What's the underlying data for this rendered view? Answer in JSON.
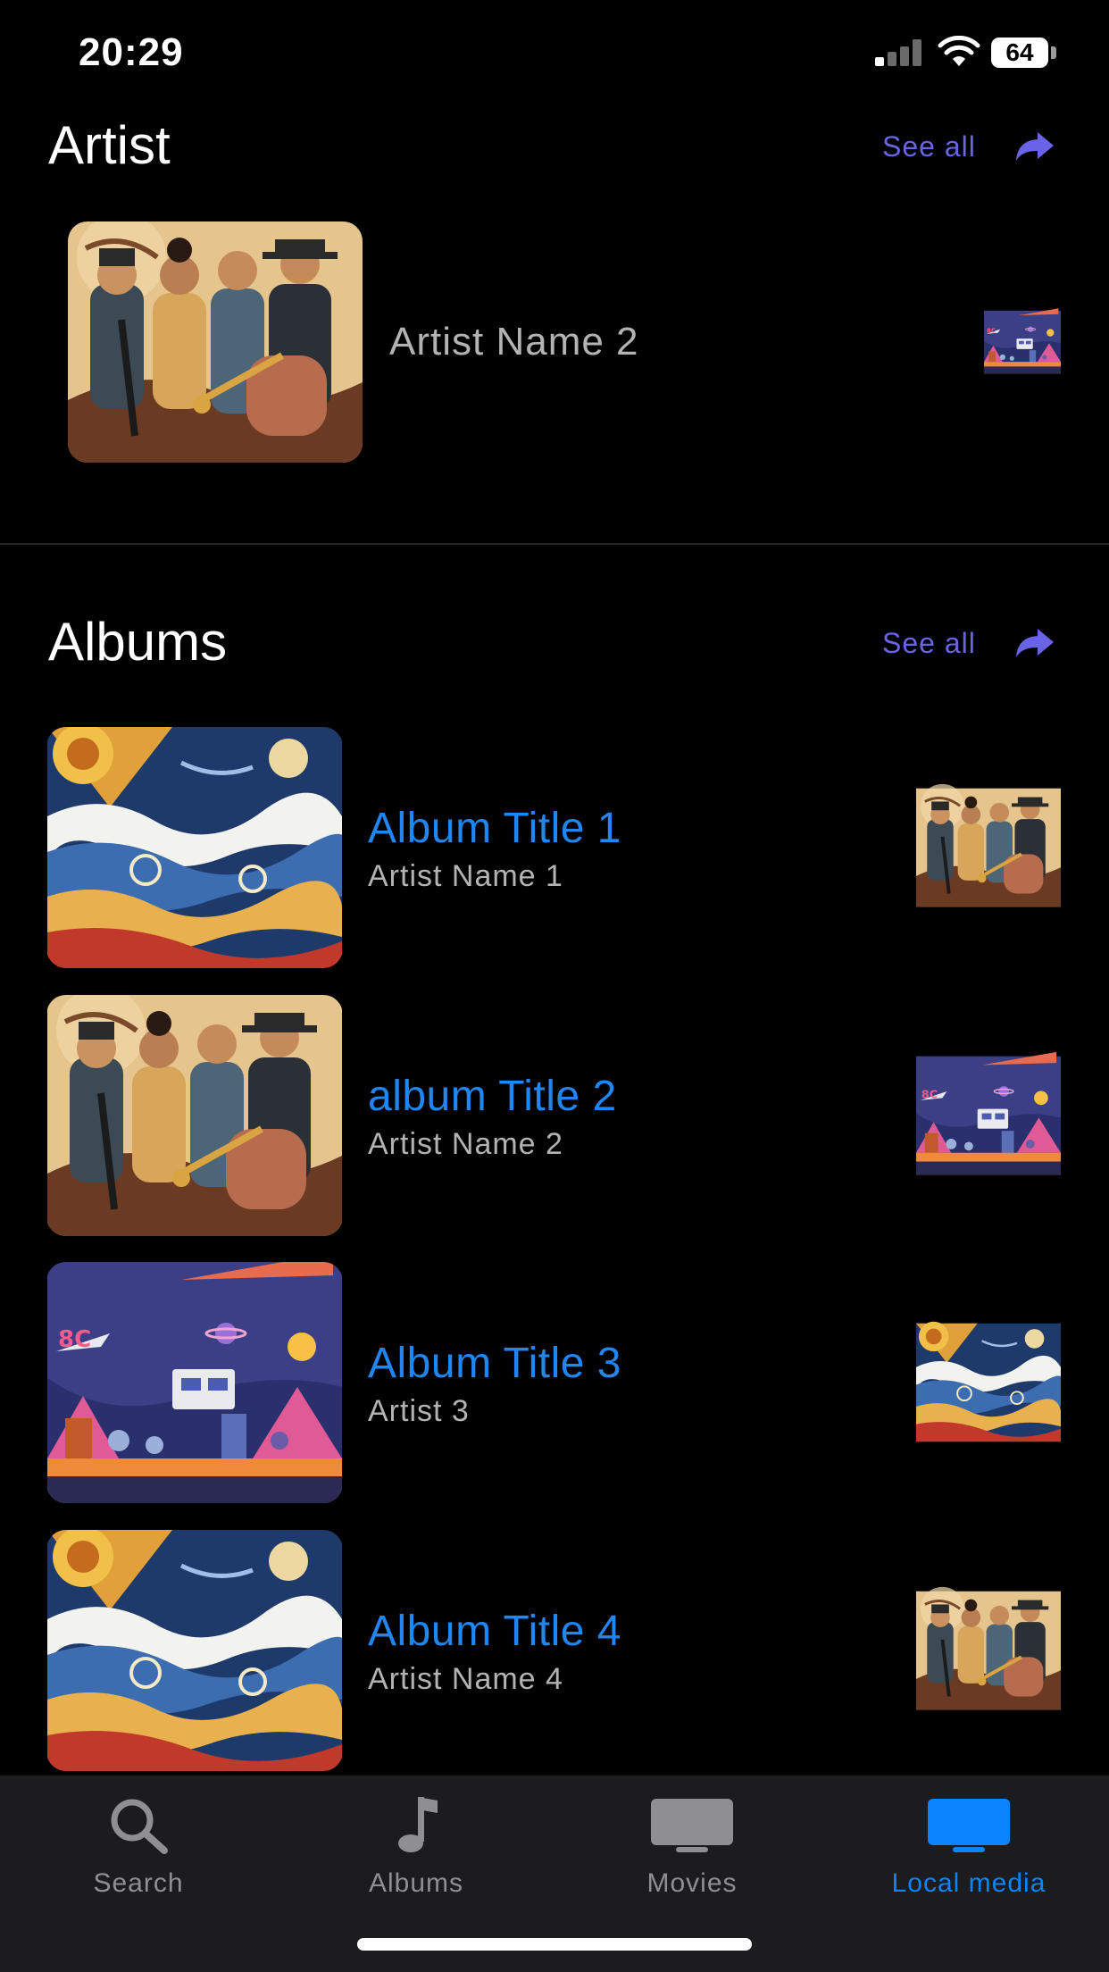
{
  "status_bar": {
    "time": "20:29",
    "battery": "64"
  },
  "artist_section": {
    "title": "Artist",
    "see_all": "See all",
    "items": [
      {
        "name": "Artist Name 2",
        "art": "jazz-band"
      },
      {
        "name": "",
        "art": "retro-space"
      }
    ]
  },
  "albums_section": {
    "title": "Albums",
    "see_all": "See all",
    "items": [
      {
        "title": "Album Title 1",
        "artist": "Artist Name 1",
        "art": "swirl-waves"
      },
      {
        "title": "album Title 2",
        "artist": "Artist Name 2",
        "art": "jazz-band"
      },
      {
        "title": "Album Title 3",
        "artist": "Artist 3",
        "art": "retro-space"
      },
      {
        "title": "Album Title 4",
        "artist": "Artist Name 4",
        "art": "swirl-waves"
      }
    ]
  },
  "tab_bar": {
    "tabs": [
      {
        "label": "Search",
        "icon": "search-icon",
        "active": false
      },
      {
        "label": "Albums",
        "icon": "music-note-icon",
        "active": false
      },
      {
        "label": "Movies",
        "icon": "tv-icon",
        "active": false
      },
      {
        "label": "Local media",
        "icon": "tv-icon",
        "active": true
      }
    ]
  },
  "colors": {
    "accent": "#1f86f2",
    "see_all": "#6a63e6",
    "tab_active": "#0a84ff",
    "tab_inactive": "#8e8e93"
  }
}
